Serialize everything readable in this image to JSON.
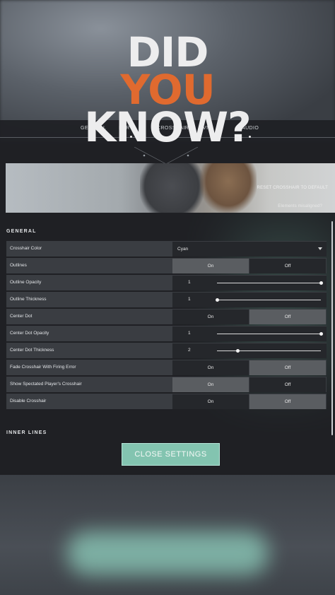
{
  "overlay": {
    "line1": "DID",
    "line2": "YOU",
    "line3": "KNOW?",
    "accent_color": "#e06a2f"
  },
  "nav": {
    "tabs": [
      "GENERAL",
      "CONTROLS",
      "CROSSHAIR",
      "VIDEO",
      "AUDIO"
    ],
    "visible_fragments": [
      "GENERAL",
      "NTR",
      "CROSSHAIR",
      "VI",
      "AUDIO"
    ]
  },
  "preview": {
    "reset_label": "RESET CROSSHAIR TO DEFAULT",
    "misaligned_label": "Elements misaligned?"
  },
  "general": {
    "title": "GENERAL",
    "crosshair_color": {
      "label": "Crosshair Color",
      "value": "Cyan"
    },
    "outlines": {
      "label": "Outlines",
      "on": "On",
      "off": "Off",
      "selected": "On"
    },
    "outline_opacity": {
      "label": "Outline Opacity",
      "value": "1",
      "fraction": 1.0
    },
    "outline_thickness": {
      "label": "Outline Thickness",
      "value": "1",
      "fraction": 0.0
    },
    "center_dot": {
      "label": "Center Dot",
      "on": "On",
      "off": "Off",
      "selected": "Off"
    },
    "center_dot_opacity": {
      "label": "Center Dot Opacity",
      "value": "1",
      "fraction": 1.0
    },
    "center_dot_thickness": {
      "label": "Center Dot Thickness",
      "value": "2",
      "fraction": 0.2
    },
    "fade_crosshair": {
      "label": "Fade Crosshair With Firing Error",
      "on": "On",
      "off": "Off",
      "selected": "Off"
    },
    "show_spectated": {
      "label": "Show Spectated Player's Crosshair",
      "on": "On",
      "off": "Off",
      "selected": "On"
    },
    "disable_crosshair": {
      "label": "Disable Crosshair",
      "on": "On",
      "off": "Off",
      "selected": "Off"
    }
  },
  "inner_lines": {
    "title": "INNER LINES"
  },
  "close_button": {
    "label": "CLOSE SETTINGS"
  },
  "colors": {
    "row_bg": "#3a3d42",
    "selected_seg": "#5a5d61",
    "unselected_seg": "#25272b",
    "button_teal": "#83c4b0"
  }
}
